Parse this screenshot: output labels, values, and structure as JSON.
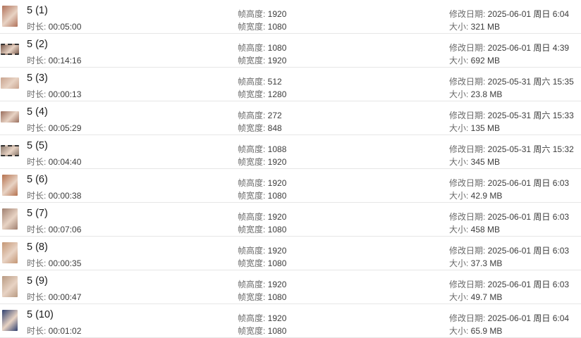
{
  "labels": {
    "duration": "时长: ",
    "frame_height": "帧高度: ",
    "frame_width": "帧宽度: ",
    "modified": "修改日期: ",
    "size": "大小: "
  },
  "files": [
    {
      "name": "5 (1)",
      "duration": "00:05:00",
      "frame_height": "1920",
      "frame_width": "1080",
      "modified": "2025-06-01 周日 6:04",
      "size": "321 MB",
      "thumb_color": "#b0715a",
      "thumb_shape": "portrait"
    },
    {
      "name": "5 (2)",
      "duration": "00:14:16",
      "frame_height": "1080",
      "frame_width": "1920",
      "modified": "2025-06-01 周日 4:39",
      "size": "692 MB",
      "thumb_color": "#7a5a4c",
      "thumb_shape": "film"
    },
    {
      "name": "5 (3)",
      "duration": "00:00:13",
      "frame_height": "512",
      "frame_width": "1280",
      "modified": "2025-05-31 周六 15:35",
      "size": "23.8 MB",
      "thumb_color": "#c9a48f",
      "thumb_shape": "landscape"
    },
    {
      "name": "5 (4)",
      "duration": "00:05:29",
      "frame_height": "272",
      "frame_width": "848",
      "modified": "2025-05-31 周六 15:33",
      "size": "135 MB",
      "thumb_color": "#9a6e5d",
      "thumb_shape": "landscape"
    },
    {
      "name": "5 (5)",
      "duration": "00:04:40",
      "frame_height": "1088",
      "frame_width": "1920",
      "modified": "2025-05-31 周六 15:32",
      "size": "345 MB",
      "thumb_color": "#8c7a6e",
      "thumb_shape": "film"
    },
    {
      "name": "5 (6)",
      "duration": "00:00:38",
      "frame_height": "1920",
      "frame_width": "1080",
      "modified": "2025-06-01 周日 6:03",
      "size": "42.9 MB",
      "thumb_color": "#b5714e",
      "thumb_shape": "portrait"
    },
    {
      "name": "5 (7)",
      "duration": "00:07:06",
      "frame_height": "1920",
      "frame_width": "1080",
      "modified": "2025-06-01 周日 6:03",
      "size": "458 MB",
      "thumb_color": "#a08070",
      "thumb_shape": "portrait"
    },
    {
      "name": "5 (8)",
      "duration": "00:00:35",
      "frame_height": "1920",
      "frame_width": "1080",
      "modified": "2025-06-01 周日 6:03",
      "size": "37.3 MB",
      "thumb_color": "#c49674",
      "thumb_shape": "portrait"
    },
    {
      "name": "5 (9)",
      "duration": "00:00:47",
      "frame_height": "1920",
      "frame_width": "1080",
      "modified": "2025-06-01 周日 6:03",
      "size": "49.7 MB",
      "thumb_color": "#b89a82",
      "thumb_shape": "portrait"
    },
    {
      "name": "5 (10)",
      "duration": "00:01:02",
      "frame_height": "1920",
      "frame_width": "1080",
      "modified": "2025-06-01 周日 6:04",
      "size": "65.9 MB",
      "thumb_color": "#2f3f6e",
      "thumb_shape": "portrait"
    }
  ]
}
